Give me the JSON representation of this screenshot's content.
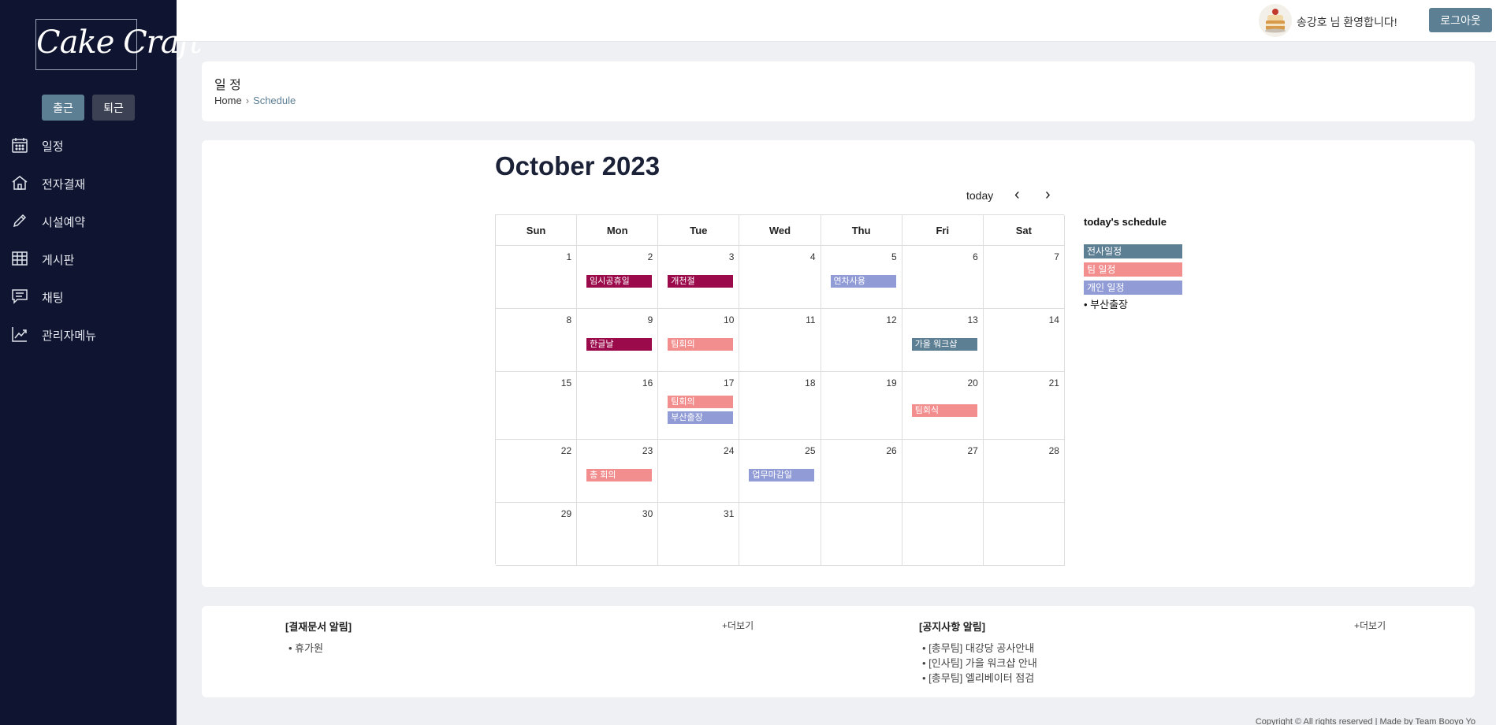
{
  "sidebar": {
    "logo": "Cake Craft",
    "clock_in": "출근",
    "clock_out": "퇴근",
    "menu": [
      {
        "label": "일정",
        "icon": "calendar-icon"
      },
      {
        "label": "전자결재",
        "icon": "home-icon"
      },
      {
        "label": "시설예약",
        "icon": "pencil-icon"
      },
      {
        "label": "게시판",
        "icon": "table-icon"
      },
      {
        "label": "채팅",
        "icon": "chat-icon"
      },
      {
        "label": "관리자메뉴",
        "icon": "chart-icon"
      }
    ]
  },
  "topbar": {
    "welcome": "송강호 님 환영합니다!",
    "logout": "로그아웃"
  },
  "page": {
    "title": "일 정",
    "breadcrumb_home": "Home",
    "breadcrumb_current": "Schedule"
  },
  "calendar": {
    "title": "October 2023",
    "today": "today",
    "days_of_week": [
      "Sun",
      "Mon",
      "Tue",
      "Wed",
      "Thu",
      "Fri",
      "Sat"
    ],
    "events": [
      {
        "day": 2,
        "title": "임시공휴일",
        "category": "company"
      },
      {
        "day": 3,
        "title": "개천절",
        "category": "company"
      },
      {
        "day": 5,
        "title": "연차사용",
        "category": "personal"
      },
      {
        "day": 9,
        "title": "한글날",
        "category": "company"
      },
      {
        "day": 10,
        "title": "팀회의",
        "category": "team"
      },
      {
        "day": 13,
        "title": "가을 워크샵",
        "category": "all"
      },
      {
        "day": 17,
        "title": "팀회의",
        "category": "team"
      },
      {
        "day": 17,
        "title": "부산출장",
        "category": "personal"
      },
      {
        "day": 20,
        "title": "팀회식",
        "category": "team"
      },
      {
        "day": 23,
        "title": "총 회의",
        "category": "team"
      },
      {
        "day": 25,
        "title": "업무마감일",
        "category": "personal"
      }
    ],
    "category_colors": {
      "company": "#9b0b4b",
      "team": "#f28e8e",
      "personal": "#919cd6",
      "all": "#5d7f94"
    }
  },
  "today_schedule": {
    "title": "today's schedule",
    "legend": [
      {
        "label": "전사일정",
        "color": "#5d7f94"
      },
      {
        "label": "팀 일정",
        "color": "#f28e8e"
      },
      {
        "label": "개인 일정",
        "color": "#919cd6"
      }
    ],
    "items": [
      "• 부산출장"
    ]
  },
  "approval_notice": {
    "title": "[결재문서 알림]",
    "more": "+더보기",
    "items": [
      "• 휴가원"
    ]
  },
  "notice_board": {
    "title": "[공지사항 알림]",
    "more": "+더보기",
    "items": [
      "• [총무팀] 대강당 공사안내",
      "• [인사팀] 가을 워크샵 안내",
      "• [총무팀] 엘리베이터 점검"
    ]
  },
  "footer": "Copyright © All rights reserved | Made by Team Booyo Yo"
}
